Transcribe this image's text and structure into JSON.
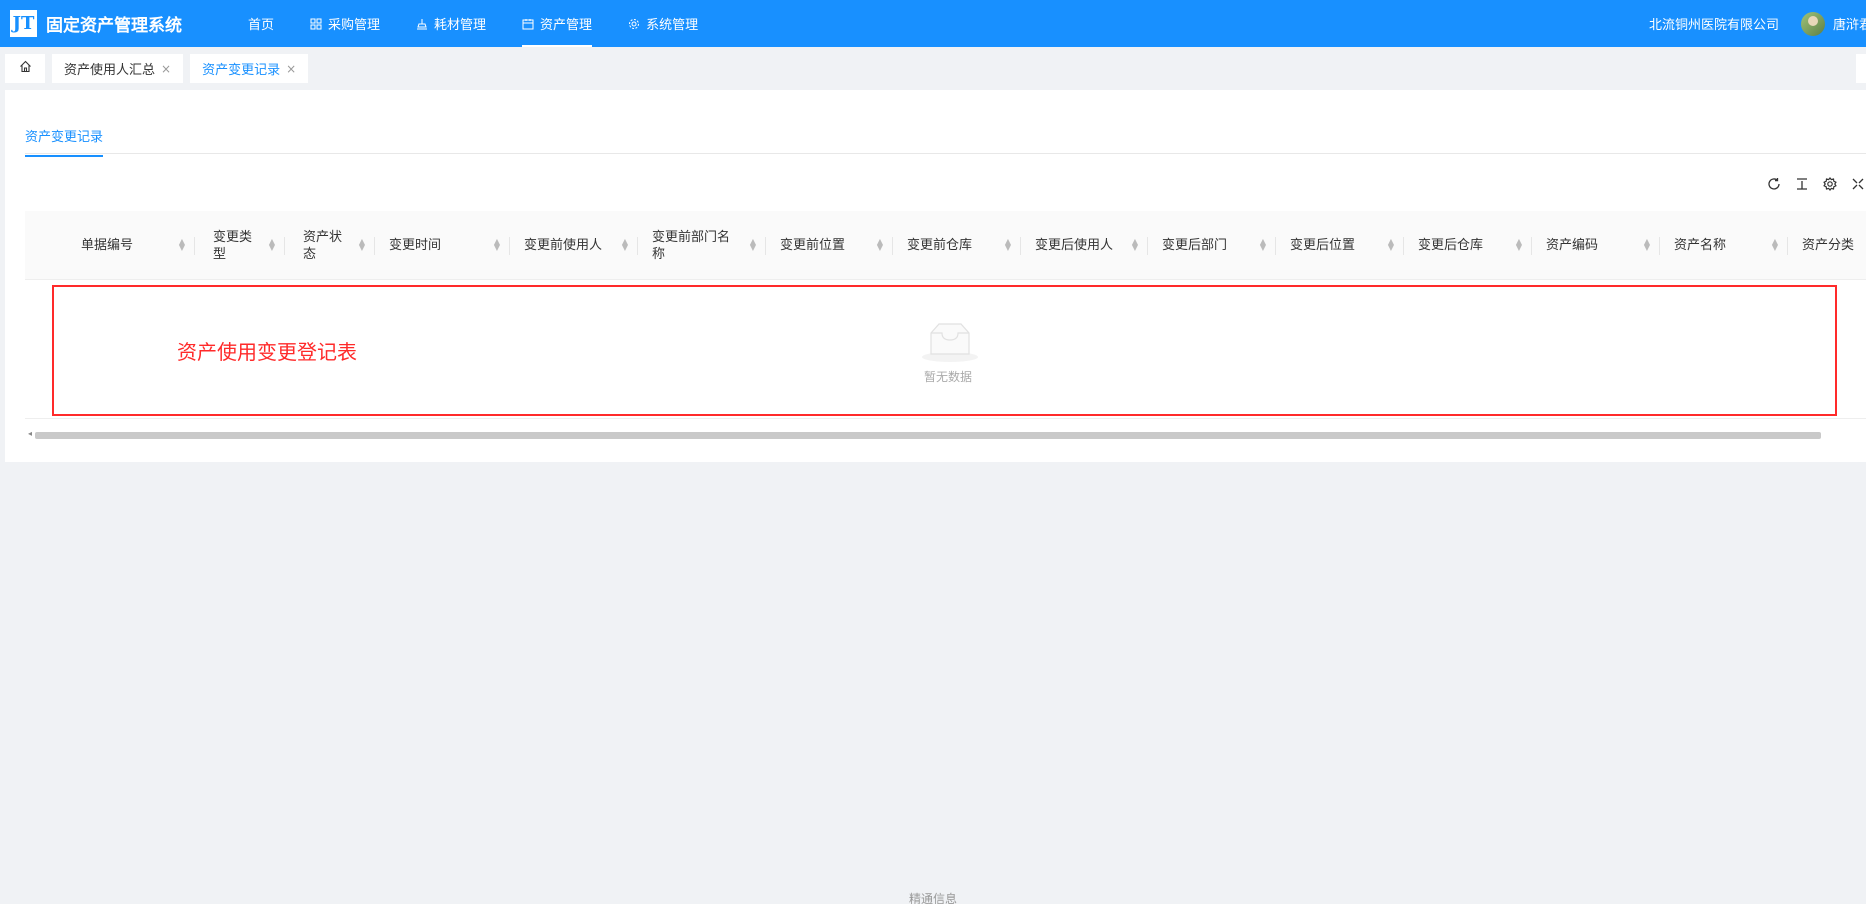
{
  "app": {
    "logo_text": "JT",
    "title": "固定资产管理系统"
  },
  "nav": [
    {
      "label": "首页",
      "icon": "none"
    },
    {
      "label": "采购管理",
      "icon": "grid-icon"
    },
    {
      "label": "耗材管理",
      "icon": "stamp-icon"
    },
    {
      "label": "资产管理",
      "icon": "calendar-icon"
    },
    {
      "label": "系统管理",
      "icon": "gear-icon"
    }
  ],
  "header": {
    "org": "北流铜州医院有限公司",
    "user": "唐浒君"
  },
  "tabs": [
    {
      "label": "资产使用人汇总",
      "close": "×"
    },
    {
      "label": "资产变更记录",
      "close": "×"
    }
  ],
  "subtab": "资产变更记录",
  "table": {
    "columns": [
      "单据编号",
      "变更类型",
      "资产状态",
      "变更时间",
      "变更前使用人",
      "变更前部门名称",
      "变更前位置",
      "变更前仓库",
      "变更后使用人",
      "变更后部门",
      "变更后位置",
      "变更后仓库",
      "资产编码",
      "资产名称",
      "资产分类"
    ],
    "empty_text": "暂无数据"
  },
  "annotation": "资产使用变更登记表",
  "footer": "精通信息",
  "colors": {
    "primary": "#1890ff",
    "annotation": "#ff2a2a"
  }
}
